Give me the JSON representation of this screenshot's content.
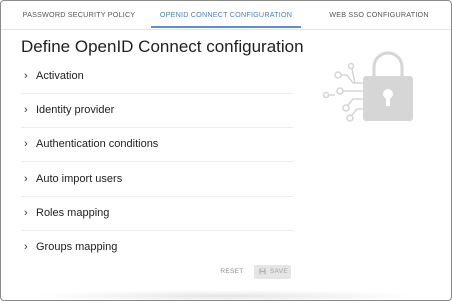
{
  "tabs": [
    {
      "label": "PASSWORD SECURITY POLICY"
    },
    {
      "label": "OPENID CONNECT CONFIGURATION"
    },
    {
      "label": "WEB SSO CONFIGURATION"
    }
  ],
  "page_title": "Define OpenID Connect configuration",
  "sections": [
    {
      "label": "Activation"
    },
    {
      "label": "Identity provider"
    },
    {
      "label": "Authentication conditions"
    },
    {
      "label": "Auto import users"
    },
    {
      "label": "Roles mapping"
    },
    {
      "label": "Groups mapping"
    }
  ],
  "actions": {
    "reset_label": "RESET",
    "save_label": "SAVE"
  },
  "colors": {
    "active_tab": "#5b8fd6",
    "illustration": "#d6d6d6"
  },
  "icons": {
    "chevron": "chevron-right-icon",
    "illustration": "padlock-circuit-icon",
    "save": "floppy-disk-icon"
  }
}
